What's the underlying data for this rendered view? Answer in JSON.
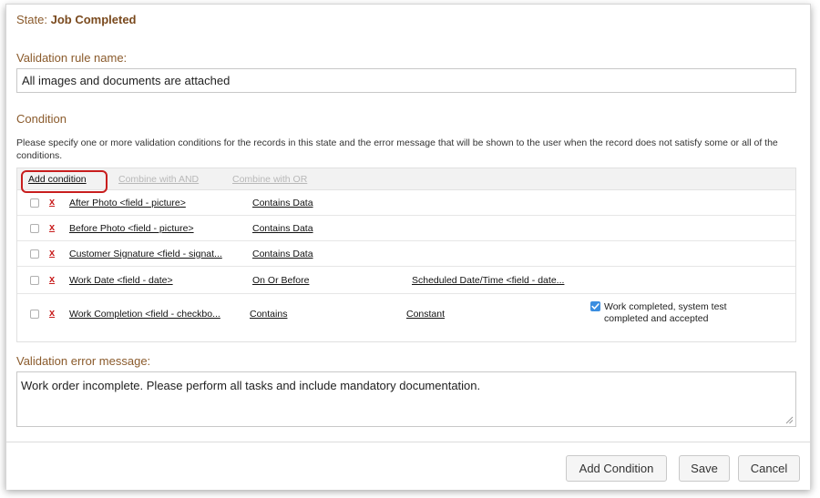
{
  "state": {
    "prefix": "State:",
    "value": "Job Completed"
  },
  "rule_name": {
    "label": "Validation rule name:",
    "value": "All images and documents are attached"
  },
  "condition": {
    "heading": "Condition",
    "description": "Please specify one or more validation conditions for the records in this state and the error message that will be shown to the user when the record does not satisfy some or all of the conditions.",
    "toolbar": {
      "add": "Add condition",
      "combine_and": "Combine with AND",
      "combine_or": "Combine with OR"
    },
    "delete_glyph": "x",
    "rows": [
      {
        "field": "After Photo <field - picture>",
        "operator": "Contains Data",
        "target": "",
        "value": "",
        "value_checked": false
      },
      {
        "field": "Before Photo <field - picture>",
        "operator": "Contains Data",
        "target": "",
        "value": "",
        "value_checked": false
      },
      {
        "field": "Customer Signature <field - signat...",
        "operator": "Contains Data",
        "target": "",
        "value": "",
        "value_checked": false
      },
      {
        "field": "Work Date <field - date>",
        "operator": "On Or Before",
        "target": "Scheduled Date/Time <field - date...",
        "value": "",
        "value_checked": false
      },
      {
        "field": "Work Completion <field - checkbo...",
        "operator": "Contains",
        "target": "Constant",
        "value": "Work completed, system test completed and accepted",
        "value_checked": true
      }
    ]
  },
  "error_message": {
    "label": "Validation error message:",
    "value": "Work order incomplete. Please perform all tasks and include mandatory documentation."
  },
  "footer": {
    "add_condition": "Add Condition",
    "save": "Save",
    "cancel": "Cancel"
  },
  "colors": {
    "label_brown": "#8a5a2b",
    "highlight_red": "#c81e1e",
    "delete_red": "#c81e1e",
    "checkbox_blue": "#3b8ee0"
  },
  "icons": {
    "resize_grip": "resize-grip-icon",
    "checkmark": "checkmark-icon",
    "delete": "delete-x-icon"
  }
}
